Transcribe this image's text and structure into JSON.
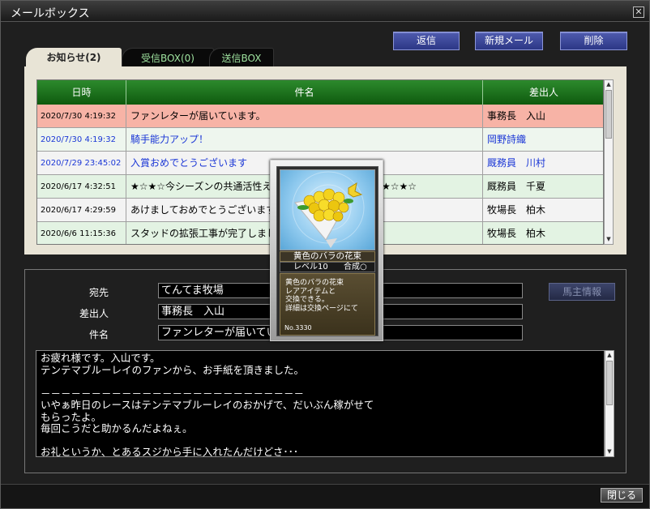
{
  "window": {
    "title": "メールボックス",
    "close_glyph": "✕"
  },
  "toolbar": {
    "reply": "返信",
    "new_mail": "新規メール",
    "delete": "削除"
  },
  "tabs": [
    {
      "label": "お知らせ(2)",
      "active": true
    },
    {
      "label": "受信BOX(0)",
      "active": false
    },
    {
      "label": "送信BOX",
      "active": false
    }
  ],
  "table": {
    "headers": [
      "日時",
      "件名",
      "差出人"
    ],
    "rows": [
      {
        "date": "2020/7/30 4:19:32",
        "subject": "ファンレターが届いています。",
        "sender": "事務長　入山",
        "state": "selected"
      },
      {
        "date": "2020/7/30 4:19:32",
        "subject": "騎手能力アップ！",
        "sender": "岡野詩織",
        "state": "unread"
      },
      {
        "date": "2020/7/29 23:45:02",
        "subject": "入賞おめでとうございます",
        "sender": "厩務員　川村",
        "state": "unread"
      },
      {
        "date": "2020/6/17 4:32:51",
        "subject": "★☆★☆今シーズンの共通活性え",
        "subject_tail": "★☆★☆",
        "sender": "厩務員　千夏",
        "state": "read"
      },
      {
        "date": "2020/6/17 4:29:59",
        "subject": "あけましておめでとうございます",
        "sender": "牧場長　柏木",
        "state": "read"
      },
      {
        "date": "2020/6/6 11:15:36",
        "subject": "スタッドの拡張工事が完了しました",
        "sender": "牧場長　柏木",
        "state": "read"
      }
    ]
  },
  "detail": {
    "to_label": "宛先",
    "to_value": "てんてま牧場",
    "from_label": "差出人",
    "from_value": "事務長　入山",
    "subject_label": "件名",
    "subject_value": "ファンレターが届いてい",
    "owner_info_button": "馬主情報",
    "body": "お疲れ様です。入山です。\nテンテマブルーレイのファンから、お手紙を頂きました。\n\n－－－－－－－－－－－－－－－－－－－－－－－－－－\nいやぁ昨日のレースはテンテマブルーレイのおかげで、だいぶん稼がせて\nもらったよ。\n毎回こうだと助かるんだよねぇ。\n\nお礼というか、とあるスジから手に入れたんだけどさ･･･"
  },
  "footer": {
    "close": "閉じる"
  },
  "tooltip_card": {
    "name": "黄色のバラの花束",
    "level": "レベル10",
    "synthesis": "合成○",
    "description": "黄色のバラの花束\nレアアイテムと\n交換できる。\n詳細は交換ページにて",
    "number": "No.3330"
  },
  "colors": {
    "header_green": "#1a6e1a",
    "row_selected": "#f7b3a6",
    "row_unread": "#eef6ee",
    "row_read": "#e3f3e3",
    "unread_text": "#1a36d6",
    "button_blue": "#3a45a0"
  }
}
